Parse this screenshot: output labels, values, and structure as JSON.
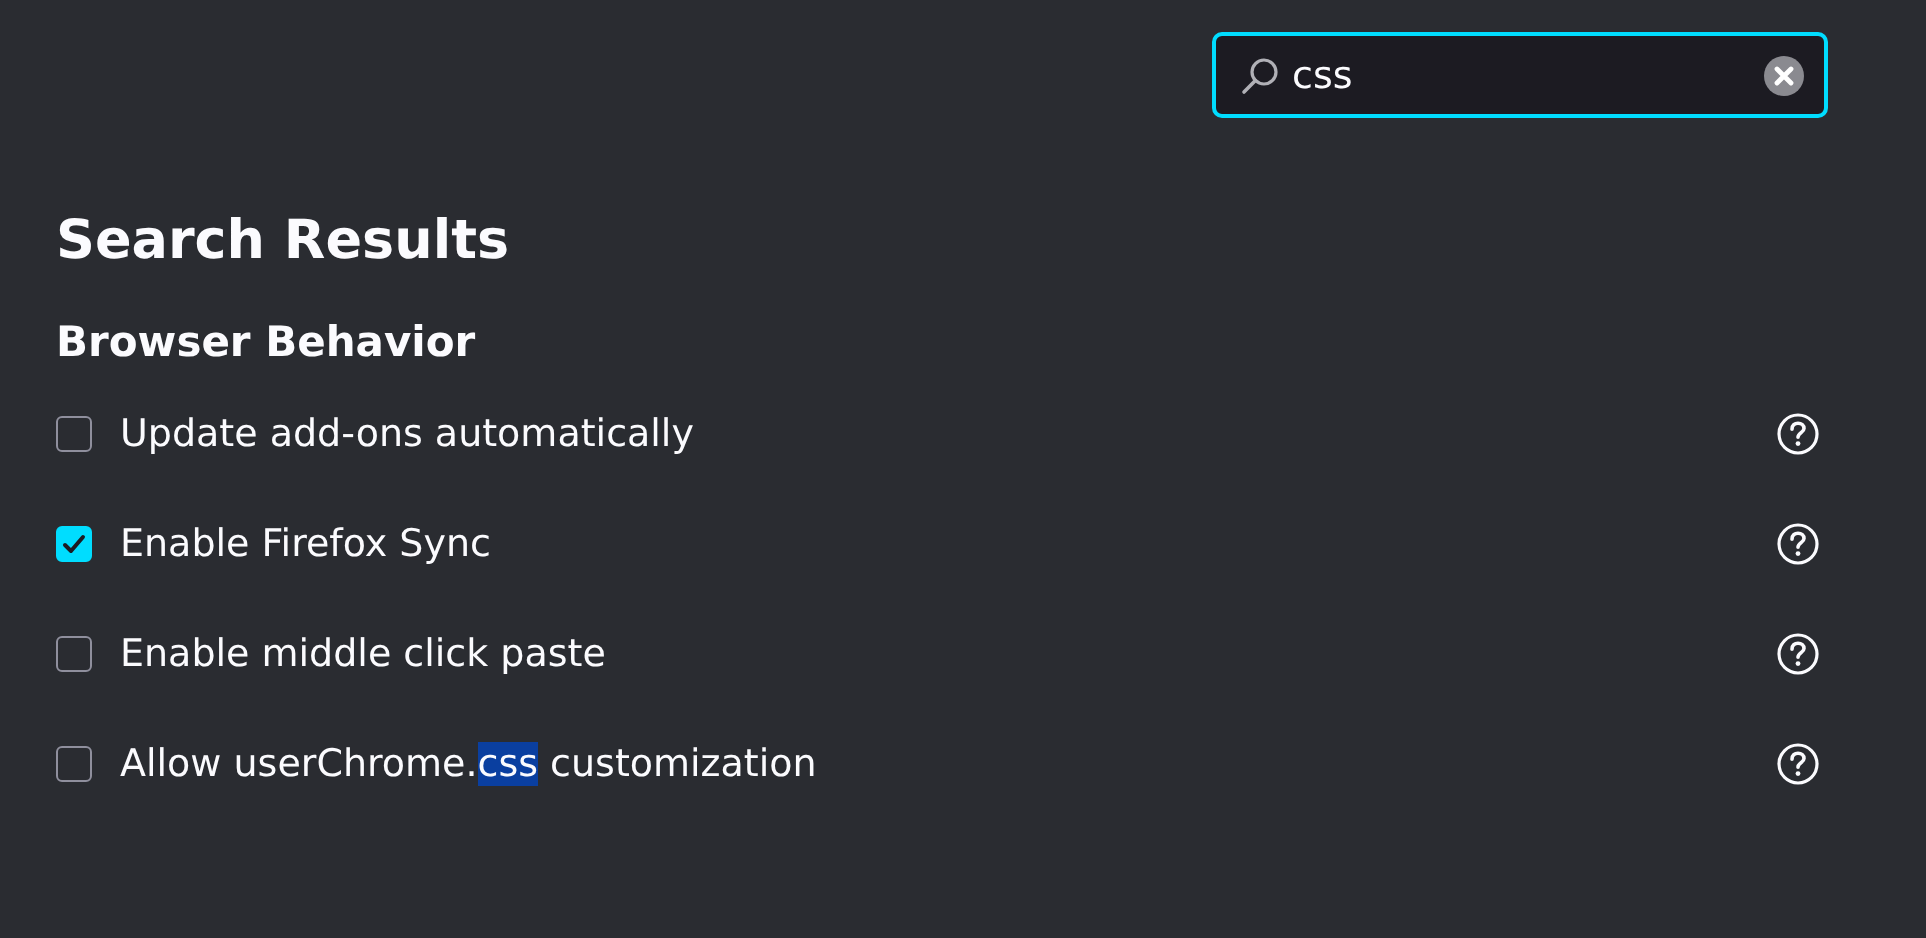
{
  "search": {
    "value": "css"
  },
  "heading": "Search Results",
  "section": {
    "title": "Browser Behavior",
    "options": [
      {
        "checked": false,
        "segments": [
          {
            "text": "Update add-ons automatically",
            "highlighted": false
          }
        ]
      },
      {
        "checked": true,
        "segments": [
          {
            "text": "Enable Firefox Sync",
            "highlighted": false
          }
        ]
      },
      {
        "checked": false,
        "segments": [
          {
            "text": "Enable middle click paste",
            "highlighted": false
          }
        ]
      },
      {
        "checked": false,
        "segments": [
          {
            "text": "Allow userChrome.",
            "highlighted": false
          },
          {
            "text": "css",
            "highlighted": true
          },
          {
            "text": " customization",
            "highlighted": false
          }
        ]
      }
    ]
  }
}
